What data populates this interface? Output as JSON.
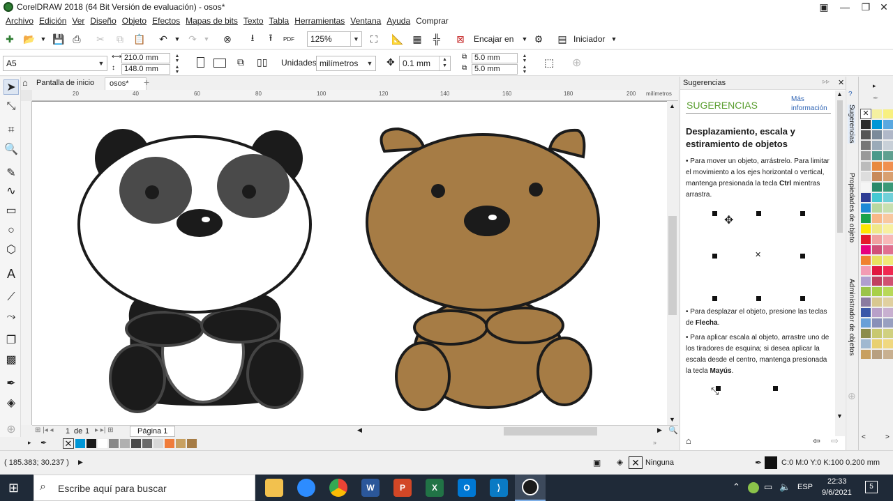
{
  "window": {
    "title": "CorelDRAW 2018 (64 Bit Versión de evaluación) - osos*"
  },
  "menu": [
    "Archivo",
    "Edición",
    "Ver",
    "Diseño",
    "Objeto",
    "Efectos",
    "Mapas de bits",
    "Texto",
    "Tabla",
    "Herramientas",
    "Ventana",
    "Ayuda",
    "Comprar"
  ],
  "toolbar": {
    "zoom": "125%",
    "snap_label": "Encajar en",
    "launcher_label": "Iniciador"
  },
  "property_bar": {
    "page_size": "A5",
    "width": "210.0 mm",
    "height": "148.0 mm",
    "units_label": "Unidades:",
    "units_value": "milímetros",
    "nudge": "0.1 mm",
    "dup_x": "5.0 mm",
    "dup_y": "5.0 mm"
  },
  "tabs": [
    {
      "label": "Pantalla de inicio"
    },
    {
      "label": "osos*"
    }
  ],
  "ruler": {
    "unit": "milímetros",
    "h_ticks": [
      "20",
      "40",
      "60",
      "80",
      "100",
      "120",
      "140",
      "160",
      "180",
      "200"
    ]
  },
  "page_nav": {
    "current": "1",
    "of_label": "de",
    "total": "1",
    "page_tab": "Página 1"
  },
  "status": {
    "coords": "( 185.383; 30.237 )",
    "fill": "Ninguna",
    "outline": "C:0 M:0 Y:0 K:100  0.200 mm"
  },
  "docker": {
    "header": "Sugerencias",
    "heading": "SUGERENCIAS",
    "more_info": "Más información",
    "topic": "Desplazamiento, escala y estiramiento de objetos",
    "tip1": "Para mover un objeto, arrástrelo. Para limitar el movimiento a los ejes horizontal o vertical, mantenga presionada la tecla",
    "tip1_key": "Ctrl",
    "tip1_end": "mientras arrastra.",
    "tip2": "Para desplazar el objeto, presione las teclas de",
    "tip2_key": "Flecha",
    "tip3": "Para aplicar escala al objeto, arrastre uno de los tiradores de esquina; si desea aplicar la escala desde el centro, mantenga presionada la tecla",
    "tip3_key": "Mayús",
    "side_tabs": [
      "Sugerencias",
      "Propiedades de objeto",
      "Administrador de objetos"
    ]
  },
  "taskbar": {
    "search_placeholder": "Escribe aquí para buscar",
    "lang": "ESP",
    "time": "22:33",
    "date": "9/6/2021",
    "notifications": "5"
  },
  "colors": {
    "accent_green": "#5a9e2f",
    "bear_brown": "#a67c45",
    "panda_gray": "#4a4a4a"
  }
}
